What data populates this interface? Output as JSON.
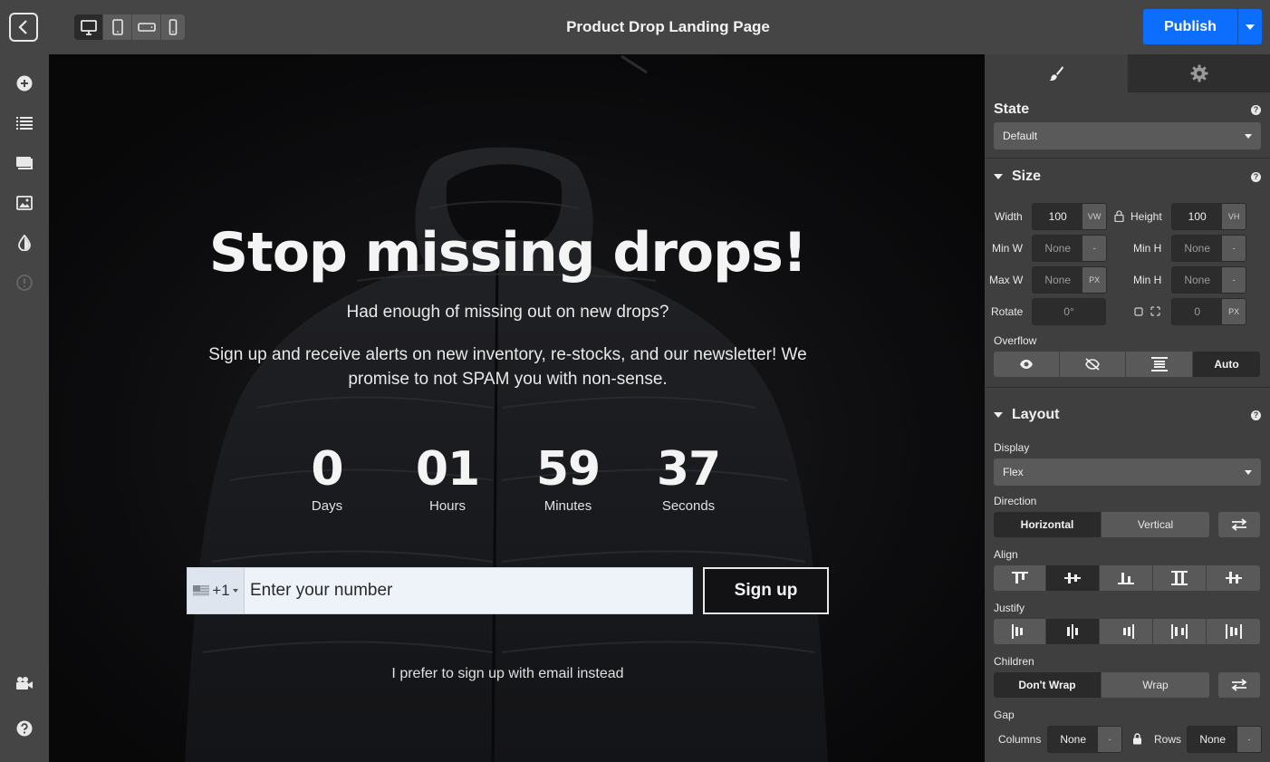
{
  "topbar": {
    "title": "Product Drop Landing Page",
    "publish_label": "Publish",
    "devices": [
      "desktop-icon",
      "tablet-icon",
      "tablet-landscape-icon",
      "mobile-icon"
    ],
    "accent": "#0d6efd"
  },
  "leftbar": {
    "icons": [
      "add-icon",
      "layers-icon",
      "pages-icon",
      "media-icon",
      "theme-icon",
      "info-icon",
      "video-icon",
      "help-icon"
    ]
  },
  "hero": {
    "headline": "Stop missing drops!",
    "subline": "Had enough of missing out on new drops?",
    "body": "Sign up and receive alerts on new inventory, re-stocks, and our newsletter! We promise to not SPAM you with non-sense.",
    "countdown": [
      {
        "value": "0",
        "label": "Days"
      },
      {
        "value": "01",
        "label": "Hours"
      },
      {
        "value": "59",
        "label": "Minutes"
      },
      {
        "value": "37",
        "label": "Seconds"
      }
    ],
    "phone": {
      "country_code": "+1",
      "placeholder": "Enter your number"
    },
    "signup_label": "Sign up",
    "email_link": "I prefer to sign up with email instead"
  },
  "panel": {
    "state": {
      "label": "State",
      "value": "Default"
    },
    "size": {
      "title": "Size",
      "width_label": "Width",
      "width_value": "100",
      "width_unit": "VW",
      "height_label": "Height",
      "height_value": "100",
      "height_unit": "VH",
      "minw_label": "Min W",
      "minw_value": "None",
      "minw_unit": "-",
      "minh_label": "Min H",
      "minh_value": "None",
      "minh_unit": "-",
      "maxw_label": "Max W",
      "maxw_value": "None",
      "maxw_unit": "PX",
      "maxh_label": "Min H",
      "maxh_value": "None",
      "maxh_unit": "-",
      "rotate_label": "Rotate",
      "rotate_value": "0°",
      "radius_value": "0",
      "radius_unit": "PX",
      "overflow_label": "Overflow",
      "overflow_active": "Auto"
    },
    "layout": {
      "title": "Layout",
      "display_label": "Display",
      "display_value": "Flex",
      "direction_label": "Direction",
      "direction_options": [
        "Horizontal",
        "Vertical"
      ],
      "align_label": "Align",
      "justify_label": "Justify",
      "children_label": "Children",
      "children_options": [
        "Don't Wrap",
        "Wrap"
      ],
      "gap_label": "Gap",
      "columns_label": "Columns",
      "columns_value": "None",
      "columns_unit": "-",
      "rows_label": "Rows",
      "rows_value": "None",
      "rows_unit": "-"
    }
  }
}
